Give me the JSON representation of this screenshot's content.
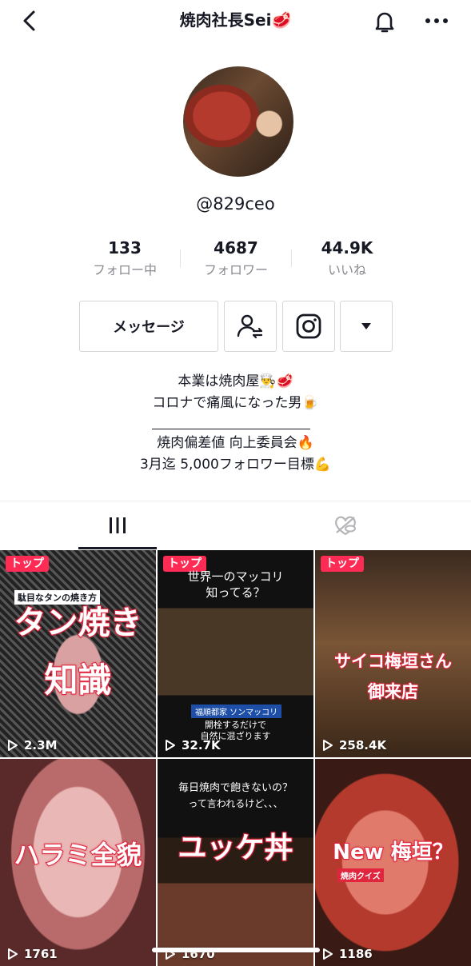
{
  "header": {
    "title": "焼肉社長Sei",
    "title_emoji": "🥩",
    "back_icon": "chevron-left-icon",
    "bell_icon": "bell-icon",
    "more_icon": "more-horizontal-icon"
  },
  "profile": {
    "handle": "@829ceo",
    "stats": [
      {
        "value": "133",
        "label": "フォロー中"
      },
      {
        "value": "4687",
        "label": "フォロワー"
      },
      {
        "value": "44.9K",
        "label": "いいね"
      }
    ],
    "message_label": "メッセージ",
    "bio": {
      "line1": "本業は焼肉屋👨‍🍳🥩",
      "line2": "コロナで痛風になった男🍺",
      "line3": "焼肉偏差値 向上委員会🔥",
      "line4": "3月迄 5,000フォロワー目標💪"
    }
  },
  "tabs": {
    "videos_icon": "grid-bars-icon",
    "liked_icon": "heart-hidden-icon"
  },
  "videos": [
    {
      "badge": "トップ",
      "caption": "駄目なタンの焼き方",
      "title1": "タン焼き",
      "title2": "知識",
      "views": "2.3M"
    },
    {
      "badge": "トップ",
      "caption1": "世界一のマッコリ",
      "caption2": "知ってる？",
      "label": "福順都家 ソンマッコリ",
      "sub1": "開栓するだけで",
      "sub2": "自然に混ざります",
      "views": "32.7K"
    },
    {
      "badge": "トップ",
      "title1": "サイコ梅垣さん",
      "title2": "御来店",
      "views": "258.4K"
    },
    {
      "title1": "ハラミ全貌",
      "views": "1761"
    },
    {
      "caption1": "毎日焼肉で飽きないの？",
      "caption2": "って言われるけど、、、",
      "title1": "ユッケ丼",
      "views": "1670"
    },
    {
      "title1": "New 梅垣？",
      "tag": "焼肉クイズ",
      "views": "1186"
    }
  ],
  "colors": {
    "accent": "#fe2c55",
    "text": "#161823",
    "muted": "#8a8b91"
  }
}
